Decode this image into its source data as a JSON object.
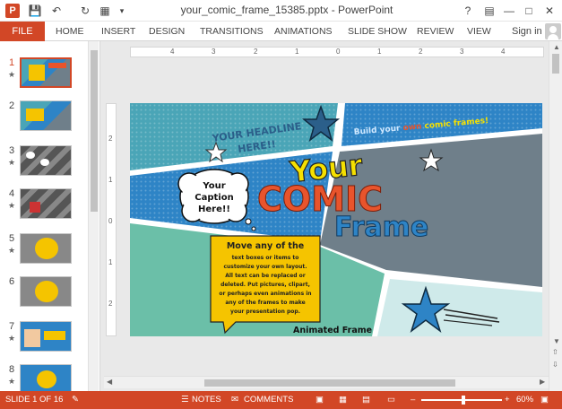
{
  "titlebar": {
    "title": "your_comic_frame_15385.pptx - PowerPoint",
    "help": "?",
    "minimize": "—",
    "maximize": "□",
    "close": "✕"
  },
  "ribbon": {
    "file": "FILE",
    "tabs": [
      "HOME",
      "INSERT",
      "DESIGN",
      "TRANSITIONS",
      "ANIMATIONS",
      "SLIDE SHOW",
      "REVIEW",
      "VIEW"
    ],
    "sign_in": "Sign in"
  },
  "thumbnails": [
    {
      "num": "1",
      "star": "★"
    },
    {
      "num": "2",
      "star": ""
    },
    {
      "num": "3",
      "star": "★"
    },
    {
      "num": "4",
      "star": "★"
    },
    {
      "num": "5",
      "star": "★"
    },
    {
      "num": "6",
      "star": ""
    },
    {
      "num": "7",
      "star": "★"
    },
    {
      "num": "8",
      "star": "★"
    }
  ],
  "ruler_top": [
    "4",
    "3",
    "2",
    "1",
    "0",
    "1",
    "2",
    "3",
    "4"
  ],
  "ruler_left": [
    "2",
    "1",
    "0",
    "1",
    "2"
  ],
  "slide": {
    "headline": [
      "YOUR HEADLINE",
      "HERE!!"
    ],
    "build_prefix": "Build your ",
    "build_own": "own",
    "build_suffix": " comic frames!",
    "caption": [
      "Your",
      "Caption",
      "Here!!"
    ],
    "big_your": "Your",
    "big_comic": "COMIC",
    "big_frame": "Frame",
    "move_title": "Move any of the",
    "move_body": [
      "text boxes or items to",
      "customize your own layout.",
      "All text can be replaced or",
      "deleted. Put pictures, clipart,",
      "or perhaps even animations in",
      "any of the frames to make",
      "your presentation pop."
    ],
    "animated": "Animated Frame"
  },
  "status": {
    "slide_info": "SLIDE 1 OF 16",
    "notes": "NOTES",
    "comments": "COMMENTS",
    "zoom": "60%"
  },
  "colors": {
    "accent": "#d24726",
    "teal": "#4aa5b7",
    "panel_blue": "#2e84c6",
    "gray": "#6f7f8a",
    "orange_text": "#e8542c",
    "yellow": "#f5c400"
  }
}
